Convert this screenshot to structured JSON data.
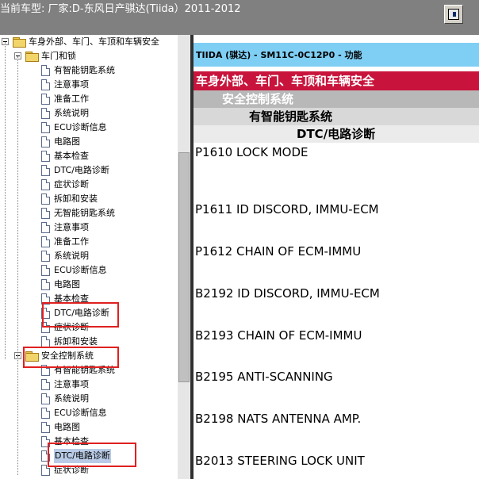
{
  "app": {
    "title": "当前车型:  厂家:D-东风日产骐达(Tiida）2011-2012"
  },
  "tree": {
    "items": [
      {
        "label": "车身外部、车门、车顶和车辆安全",
        "type": "folder",
        "level": 0,
        "expanded": true
      },
      {
        "label": "车门和锁",
        "type": "folder",
        "level": 1,
        "expanded": true
      },
      {
        "label": "有智能钥匙系统",
        "type": "doc",
        "level": 2
      },
      {
        "label": "注意事项",
        "type": "doc",
        "level": 2
      },
      {
        "label": "准备工作",
        "type": "doc",
        "level": 2
      },
      {
        "label": "系统说明",
        "type": "doc",
        "level": 2
      },
      {
        "label": "ECU诊断信息",
        "type": "doc",
        "level": 2
      },
      {
        "label": "电路图",
        "type": "doc",
        "level": 2
      },
      {
        "label": "基本检查",
        "type": "doc",
        "level": 2
      },
      {
        "label": "DTC/电路诊断",
        "type": "doc",
        "level": 2
      },
      {
        "label": "症状诊断",
        "type": "doc",
        "level": 2
      },
      {
        "label": "拆卸和安装",
        "type": "doc",
        "level": 2
      },
      {
        "label": "无智能钥匙系统",
        "type": "doc",
        "level": 2
      },
      {
        "label": "注意事项",
        "type": "doc",
        "level": 2
      },
      {
        "label": "准备工作",
        "type": "doc",
        "level": 2
      },
      {
        "label": "系统说明",
        "type": "doc",
        "level": 2
      },
      {
        "label": "ECU诊断信息",
        "type": "doc",
        "level": 2
      },
      {
        "label": "电路图",
        "type": "doc",
        "level": 2
      },
      {
        "label": "基本检查",
        "type": "doc",
        "level": 2
      },
      {
        "label": "DTC/电路诊断",
        "type": "doc",
        "level": 2
      },
      {
        "label": "症状诊断",
        "type": "doc",
        "level": 2
      },
      {
        "label": "拆卸和安装",
        "type": "doc",
        "level": 2
      },
      {
        "label": "安全控制系统",
        "type": "folder",
        "level": 1,
        "expanded": true
      },
      {
        "label": "有智能钥匙系统",
        "type": "doc",
        "level": 2
      },
      {
        "label": "注意事项",
        "type": "doc",
        "level": 2
      },
      {
        "label": "系统说明",
        "type": "doc",
        "level": 2
      },
      {
        "label": "ECU诊断信息",
        "type": "doc",
        "level": 2
      },
      {
        "label": "电路图",
        "type": "doc",
        "level": 2
      },
      {
        "label": "基本检查",
        "type": "doc",
        "level": 2
      },
      {
        "label": "DTC/电路诊断",
        "type": "doc",
        "level": 2,
        "selected": true
      },
      {
        "label": "症状诊断",
        "type": "doc",
        "level": 2
      }
    ]
  },
  "content": {
    "header": "TIIDA (骐达) - SM11C-0C12P0 - 功能",
    "breadcrumb": [
      "车身外部、车门、车顶和车辆安全",
      "安全控制系统",
      "有智能钥匙系统",
      "DTC/电路诊断"
    ],
    "dtc_codes": [
      "P1610 LOCK MODE",
      "P1611 ID DISCORD, IMMU-ECM",
      "P1612 CHAIN OF ECM-IMMU",
      "B2192 ID DISCORD, IMMU-ECM",
      "B2193 CHAIN OF ECM-IMMU",
      "B2195 ANTI-SCANNING",
      "B2198 NATS ANTENNA AMP.",
      "B2013 STEERING LOCK UNIT"
    ]
  },
  "colors": {
    "topbar": "#808080",
    "header_band": "#7fcff5",
    "breadcrumb_red": "#c8143c",
    "highlight": "#e02020"
  },
  "icons": {
    "window_button": "window-toggle-icon",
    "folder": "folder-icon",
    "document": "document-icon",
    "expander": "collapse-icon"
  }
}
